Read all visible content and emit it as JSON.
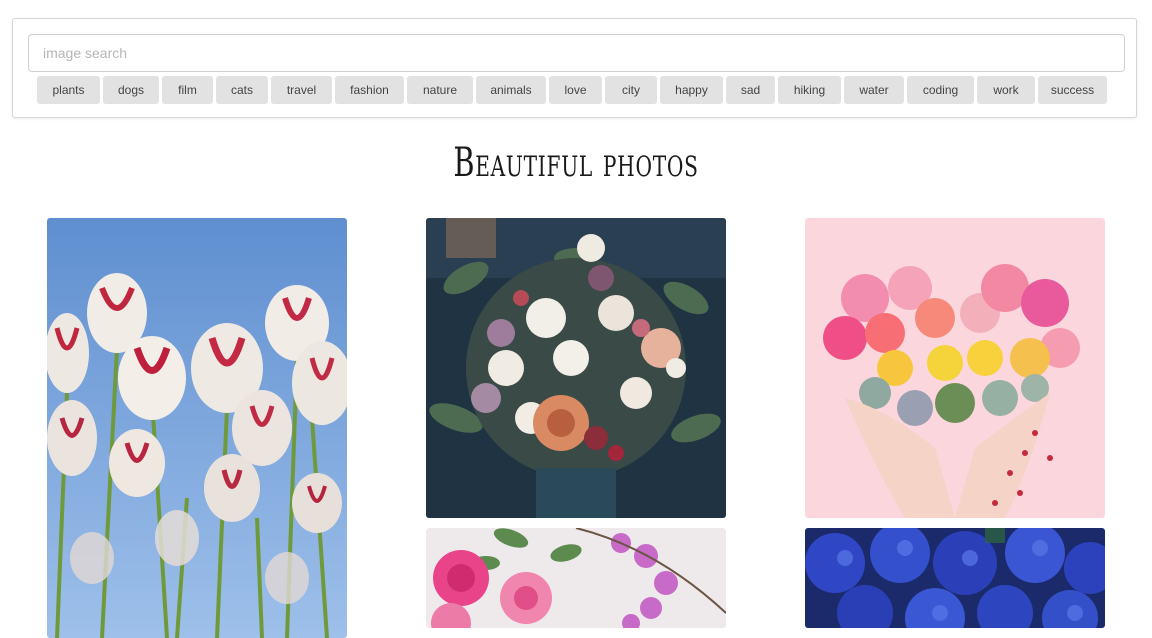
{
  "search": {
    "placeholder": "image search",
    "value": ""
  },
  "tags": [
    "plants",
    "dogs",
    "film",
    "cats",
    "travel",
    "fashion",
    "nature",
    "animals",
    "love",
    "city",
    "happy",
    "sad",
    "hiking",
    "water",
    "coding",
    "work",
    "success"
  ],
  "title": "Beautiful photos",
  "photos": [
    {
      "subject": "tulips-icon"
    },
    {
      "subject": "bouquet-icon"
    },
    {
      "subject": "heart-flowers-icon"
    },
    {
      "subject": "roses-orchid-icon"
    },
    {
      "subject": "hydrangea-icon"
    }
  ]
}
